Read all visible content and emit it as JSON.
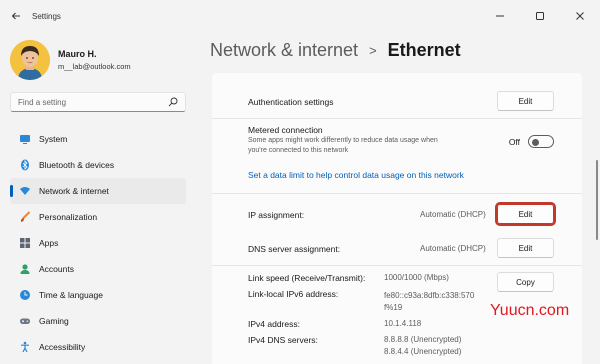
{
  "window": {
    "title": "Settings",
    "controls": [
      "minimize-icon",
      "maximize-icon",
      "close-icon"
    ]
  },
  "profile": {
    "name": "Mauro H.",
    "email": "m__lab@outlook.com"
  },
  "search": {
    "placeholder": "Find a setting"
  },
  "sidebar": {
    "items": [
      {
        "label": "System",
        "icon": "monitor-icon"
      },
      {
        "label": "Bluetooth & devices",
        "icon": "bluetooth-icon"
      },
      {
        "label": "Network & internet",
        "icon": "wifi-icon",
        "active": true
      },
      {
        "label": "Personalization",
        "icon": "brush-icon"
      },
      {
        "label": "Apps",
        "icon": "apps-icon"
      },
      {
        "label": "Accounts",
        "icon": "person-icon"
      },
      {
        "label": "Time & language",
        "icon": "globe-clock-icon"
      },
      {
        "label": "Gaming",
        "icon": "gamepad-icon"
      },
      {
        "label": "Accessibility",
        "icon": "accessibility-icon"
      }
    ]
  },
  "breadcrumb": {
    "parent": "Network & internet",
    "separator": ">",
    "current": "Ethernet"
  },
  "content": {
    "auth": {
      "label": "Authentication settings",
      "button": "Edit"
    },
    "metered": {
      "label": "Metered connection",
      "description": "Some apps might work differently to reduce data usage when you're connected to this network",
      "toggle_label": "Off",
      "toggle_on": false
    },
    "data_limit_link": "Set a data limit to help control data usage on this network",
    "ip": {
      "label": "IP assignment:",
      "value": "Automatic (DHCP)",
      "button": "Edit"
    },
    "dns": {
      "label": "DNS server assignment:",
      "value": "Automatic (DHCP)",
      "button": "Edit"
    },
    "link_speed": {
      "label": "Link speed (Receive/Transmit):",
      "value": "1000/1000 (Mbps)"
    },
    "copy_button": "Copy",
    "ipv6": {
      "label": "Link-local IPv6 address:",
      "value_line1": "fe80::c93a:8dfb:c338:570",
      "value_line2": "f%19"
    },
    "ipv4": {
      "label": "IPv4 address:",
      "value": "10.1.4.118"
    },
    "ipv4dns": {
      "label": "IPv4 DNS servers:",
      "value_line1": "8.8.8.8 (Unencrypted)",
      "value_line2": "8.8.4.4 (Unencrypted)"
    }
  },
  "watermark": "Yuucn.com",
  "colors": {
    "accent": "#005fb8",
    "highlight_border": "#c0392b",
    "watermark": "#e0181f"
  }
}
